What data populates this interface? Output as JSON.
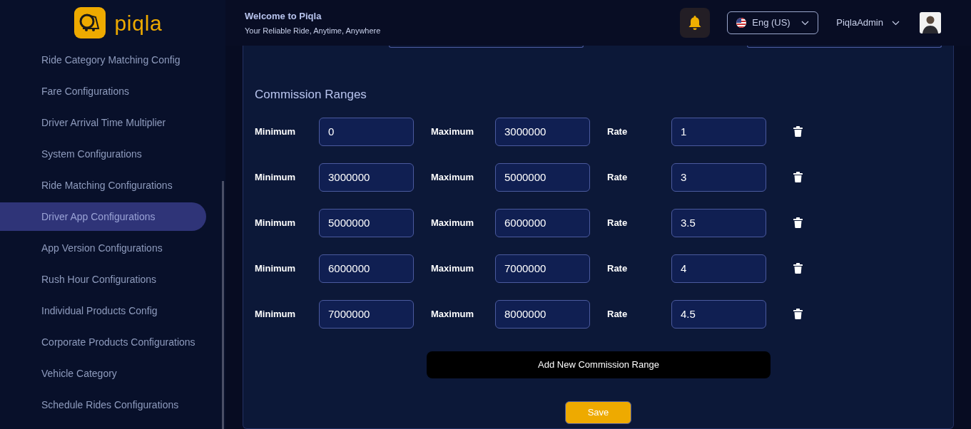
{
  "brand": {
    "name": "piqla"
  },
  "sidebar": {
    "items": [
      {
        "label": "Ride Category Matching Config",
        "selected": false
      },
      {
        "label": "Fare Configurations",
        "selected": false
      },
      {
        "label": "Driver Arrival Time Multiplier",
        "selected": false
      },
      {
        "label": "System Configurations",
        "selected": false
      },
      {
        "label": "Ride Matching Configurations",
        "selected": false
      },
      {
        "label": "Driver App Configurations",
        "selected": true
      },
      {
        "label": "App Version Configurations",
        "selected": false
      },
      {
        "label": "Rush Hour Configurations",
        "selected": false
      },
      {
        "label": "Individual Products Config",
        "selected": false
      },
      {
        "label": "Corporate Products Configurations",
        "selected": false
      },
      {
        "label": "Vehicle Category",
        "selected": false
      },
      {
        "label": "Schedule Rides Configurations",
        "selected": false
      }
    ]
  },
  "header": {
    "title": "Welcome to Piqla",
    "subtitle": "Your Reliable Ride, Anytime, Anywhere",
    "language": "Eng (US)",
    "user": "PiqlaAdmin"
  },
  "commission": {
    "title": "Commission Ranges",
    "rows": [
      {
        "min_label": "Minimum",
        "minimum": "0",
        "max_label": "Maximum",
        "maximum": "3000000",
        "rate_label": "Rate",
        "rate": "1"
      },
      {
        "min_label": "Minimum",
        "minimum": "3000000",
        "max_label": "Maximum",
        "maximum": "5000000",
        "rate_label": "Rate",
        "rate": "3"
      },
      {
        "min_label": "Minimum",
        "minimum": "5000000",
        "max_label": "Maximum",
        "maximum": "6000000",
        "rate_label": "Rate",
        "rate": "3.5"
      },
      {
        "min_label": "Minimum",
        "minimum": "6000000",
        "max_label": "Maximum",
        "maximum": "7000000",
        "rate_label": "Rate",
        "rate": "4"
      },
      {
        "min_label": "Minimum",
        "minimum": "7000000",
        "max_label": "Maximum",
        "maximum": "8000000",
        "rate_label": "Rate",
        "rate": "4.5"
      }
    ],
    "add_button": "Add New Commission Range",
    "save_button": "Save"
  }
}
